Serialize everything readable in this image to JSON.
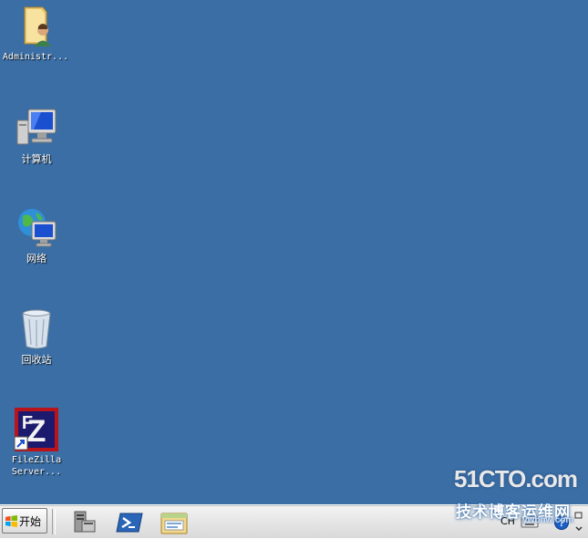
{
  "desktop": {
    "background_color": "#3a6ea5",
    "icons": [
      {
        "label": "Administr...",
        "icon": "user-folder-icon"
      },
      {
        "label": "计算机",
        "icon": "computer-icon"
      },
      {
        "label": "网络",
        "icon": "network-globe-icon"
      },
      {
        "label": "回收站",
        "icon": "recycle-bin-icon"
      },
      {
        "label": "FileZilla\nServer...",
        "icon": "filezilla-server-shortcut-icon"
      }
    ]
  },
  "taskbar": {
    "start_label": "开始",
    "quick_launch": [
      {
        "icon": "server-manager-icon"
      },
      {
        "icon": "powershell-icon"
      },
      {
        "icon": "explorer-folder-icon"
      }
    ],
    "tray": {
      "language": "CH"
    }
  },
  "watermark": {
    "brand": "51CTO.com",
    "tagline": "技术博客运维网",
    "url": "ywbnw.com"
  }
}
